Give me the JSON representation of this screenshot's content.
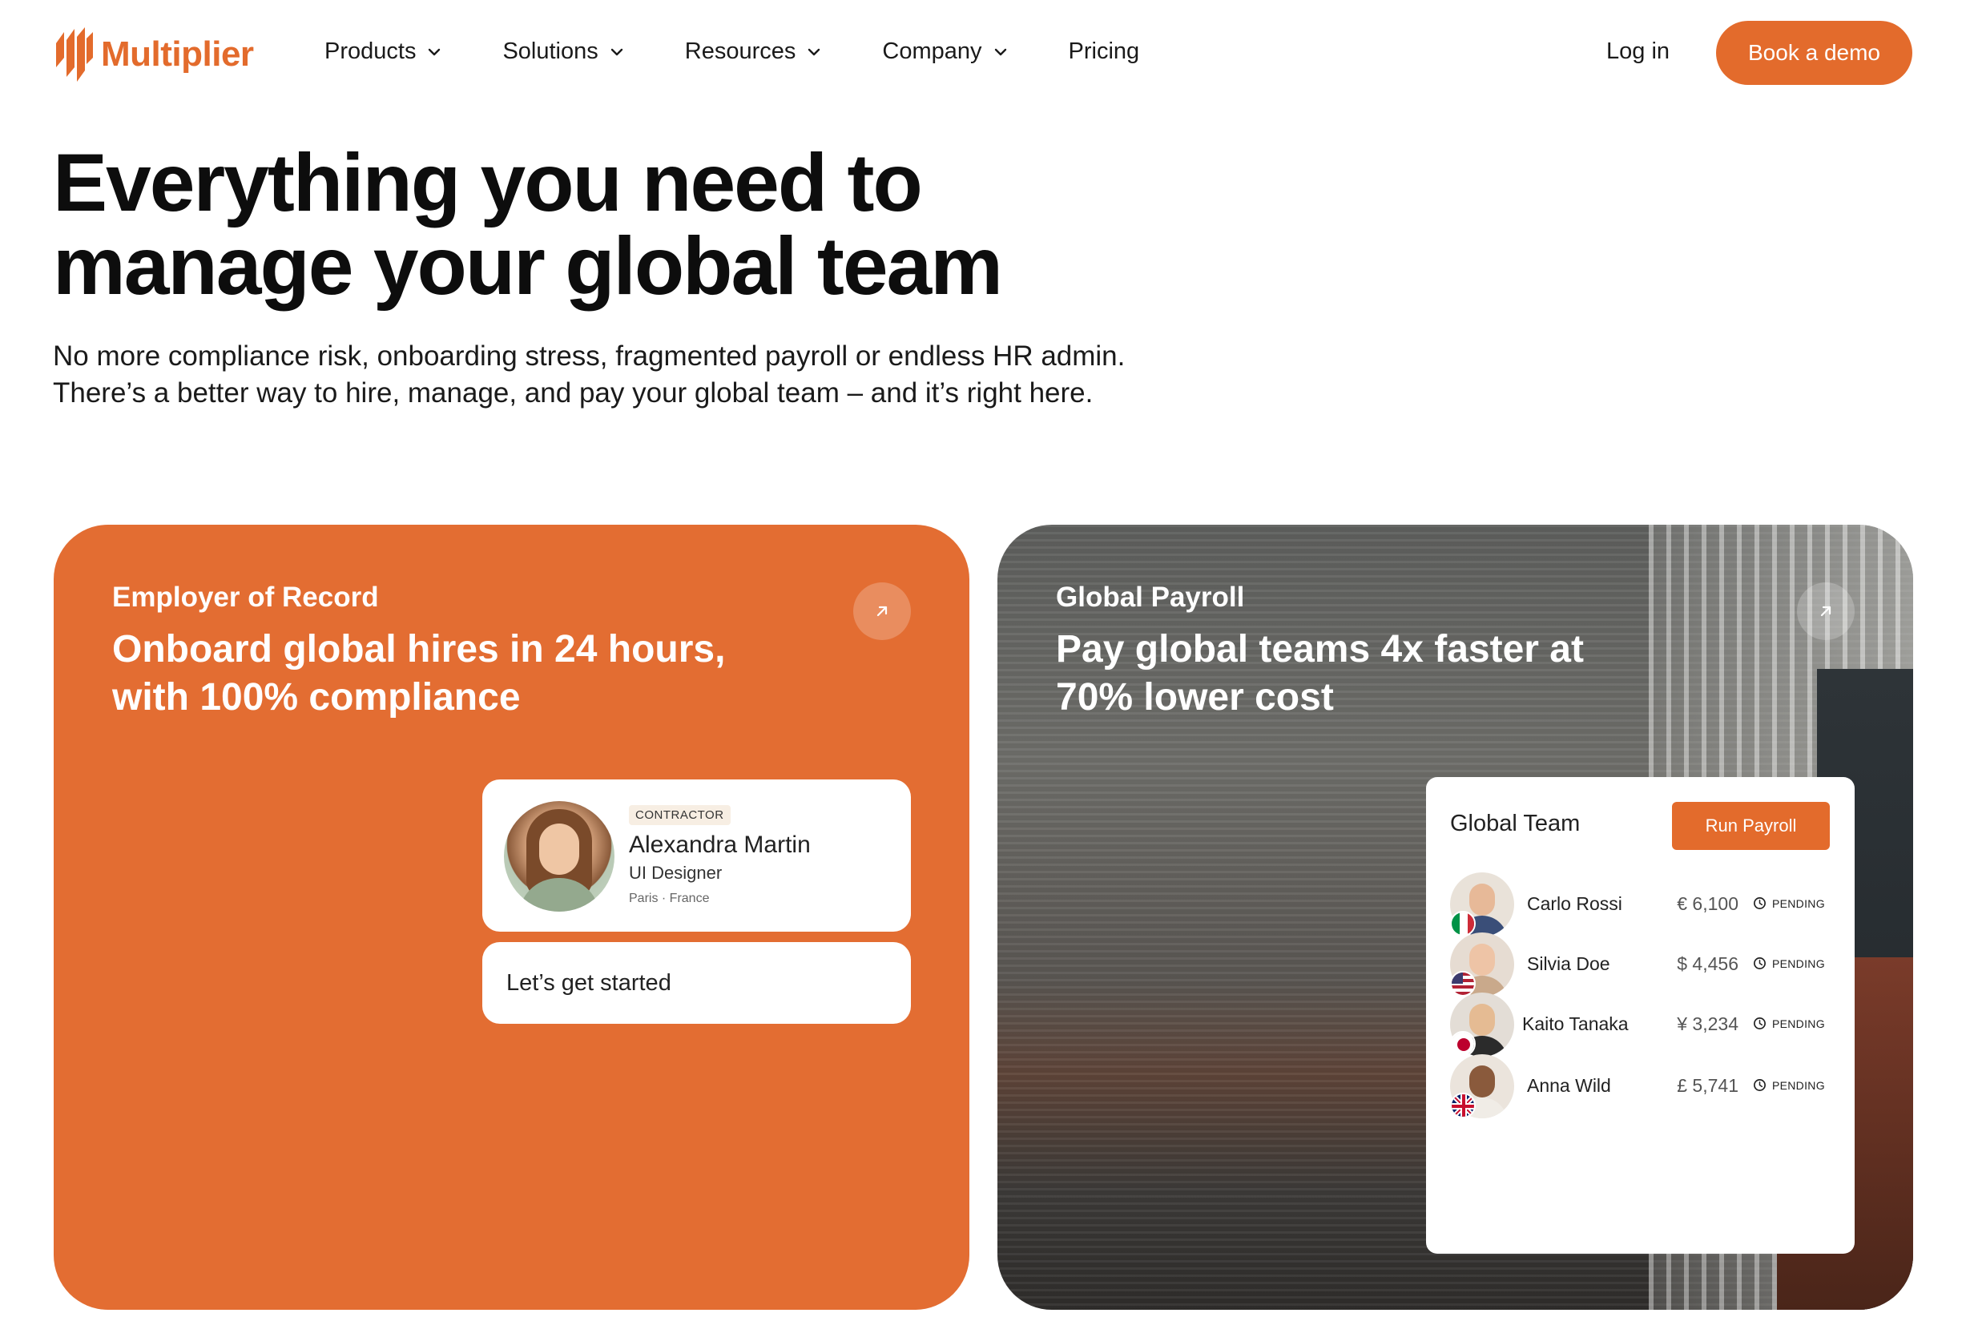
{
  "brand": {
    "name": "Multiplier",
    "color": "#e36b2c"
  },
  "nav": {
    "items": [
      {
        "label": "Products",
        "has_dropdown": true
      },
      {
        "label": "Solutions",
        "has_dropdown": true
      },
      {
        "label": "Resources",
        "has_dropdown": true
      },
      {
        "label": "Company",
        "has_dropdown": true
      },
      {
        "label": "Pricing",
        "has_dropdown": false
      }
    ],
    "login_label": "Log in",
    "demo_label": "Book a demo"
  },
  "hero": {
    "title_line1": "Everything you need to",
    "title_line2": "manage your global team",
    "subtitle_line1": "No more compliance risk, onboarding stress, fragmented payroll or endless HR admin.",
    "subtitle_line2": "There’s a better way to hire, manage, and pay your global team – and it’s right here."
  },
  "cards": {
    "eor": {
      "eyebrow": "Employer of Record",
      "title_line1": "Onboard global hires in 24 hours,",
      "title_line2": "with 100% compliance",
      "arrow_icon": "arrow-up-right-icon",
      "profile": {
        "badge": "CONTRACTOR",
        "name": "Alexandra Martin",
        "role": "UI Designer",
        "location": "Paris · France"
      },
      "cta": "Let’s get started"
    },
    "payroll": {
      "eyebrow": "Global Payroll",
      "title_line1": "Pay global teams 4x faster at",
      "title_line2": "70% lower cost",
      "arrow_icon": "arrow-up-right-icon",
      "team": {
        "title": "Global Team",
        "run_label": "Run Payroll",
        "rows": [
          {
            "name": "Carlo Rossi",
            "amount": "€ 6,100",
            "status": "PENDING",
            "flag": "italy-flag-icon"
          },
          {
            "name": "Silvia Doe",
            "amount": "$ 4,456",
            "status": "PENDING",
            "flag": "usa-flag-icon"
          },
          {
            "name": "Kaito Tanaka",
            "amount": "¥ 3,234",
            "status": "PENDING",
            "flag": "japan-flag-icon"
          },
          {
            "name": "Anna Wild",
            "amount": "£ 5,741",
            "status": "PENDING",
            "flag": "uk-flag-icon"
          }
        ]
      }
    }
  }
}
